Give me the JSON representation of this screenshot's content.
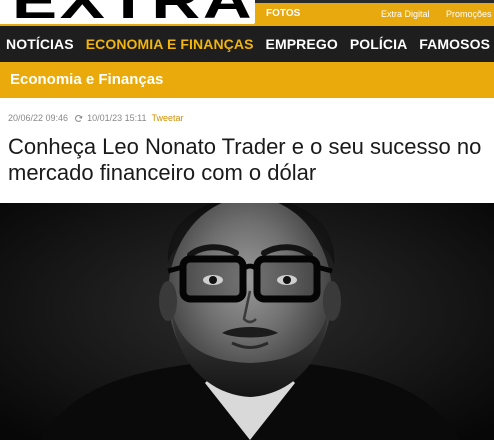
{
  "brand": {
    "logo_text": "EXTRA",
    "top_links": [
      "FOTOS",
      "Extra Digital",
      "Promoções"
    ]
  },
  "nav": {
    "items": [
      {
        "label": "NOTÍCIAS",
        "active": false
      },
      {
        "label": "ECONOMIA E FINANÇAS",
        "active": true
      },
      {
        "label": "EMPREGO",
        "active": false
      },
      {
        "label": "POLÍCIA",
        "active": false
      },
      {
        "label": "FAMOSOS",
        "active": false
      }
    ]
  },
  "section": {
    "title": "Economia e Finanças"
  },
  "article": {
    "published": "20/06/22 09:46",
    "updated": "10/01/23 15:11",
    "tweet_label": "Tweetar",
    "headline": "Conheça Leo Nonato Trader e o seu sucesso no mercado financeiro com o dólar"
  },
  "icons": {
    "updated": "refresh-icon"
  },
  "colors": {
    "brand_yellow": "#eaaa0c",
    "nav_background": "#1e1e1e",
    "nav_active": "#f2b50f",
    "tweet_link": "#d48f00"
  }
}
